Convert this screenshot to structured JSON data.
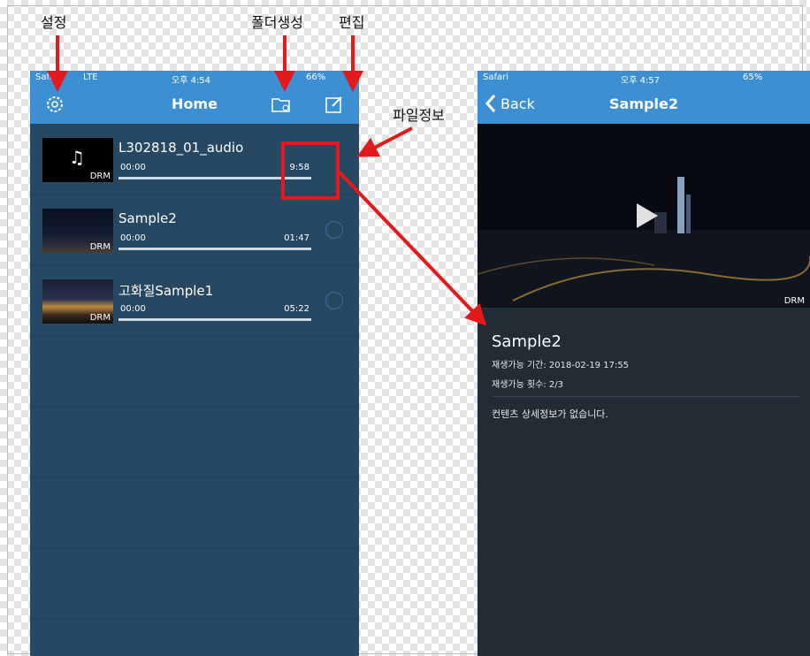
{
  "annotations": {
    "settings": "설정",
    "create_folder": "폴더생성",
    "edit": "편집",
    "file_info": "파일정보"
  },
  "left_phone": {
    "status": {
      "carrier": "Safari",
      "network": "LTE",
      "time": "오후 4:54",
      "battery": "66%"
    },
    "nav_title": "Home",
    "items": [
      {
        "title": "L302818_01_audio",
        "start": "00:00",
        "end": "9:58",
        "drm": "DRM",
        "thumb": "audio"
      },
      {
        "title": "Sample2",
        "start": "00:00",
        "end": "01:47",
        "drm": "DRM",
        "thumb": "city"
      },
      {
        "title": "고화질Sample1",
        "start": "00:00",
        "end": "05:22",
        "drm": "DRM",
        "thumb": "sunset"
      }
    ]
  },
  "right_phone": {
    "status": {
      "carrier": "Safari",
      "time": "오후 4:57",
      "battery": "65%"
    },
    "back_label": "Back",
    "nav_title": "Sample2",
    "video_drm": "DRM",
    "detail": {
      "title": "Sample2",
      "period": "재생가능 기간: 2018-02-19 17:55",
      "count": "재생가능 횟수: 2/3",
      "description": "컨텐츠 상세정보가 없습니다."
    }
  },
  "colors": {
    "navbar": "#3d8fd3",
    "list_bg": "#264863",
    "detail_bg": "#212c35",
    "arrow": "#e3191b"
  }
}
